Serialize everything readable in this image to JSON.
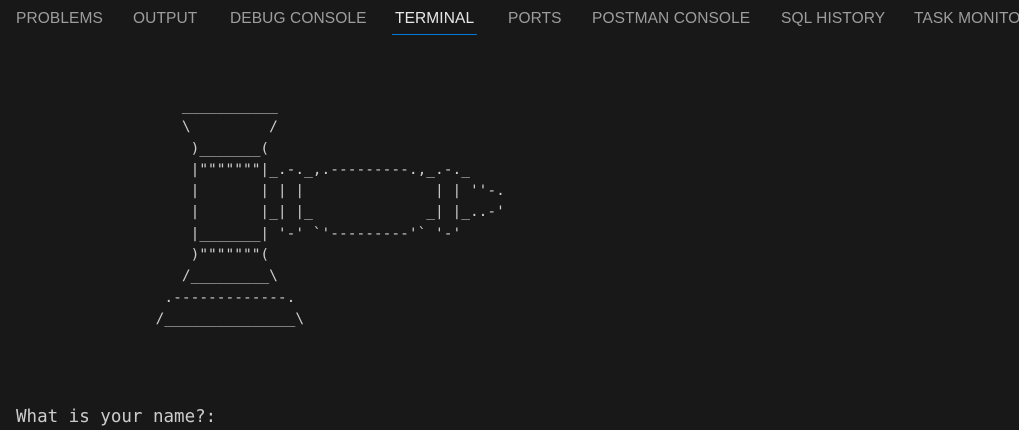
{
  "tabs": [
    {
      "label": "PROBLEMS",
      "active": false
    },
    {
      "label": "OUTPUT",
      "active": false
    },
    {
      "label": "DEBUG CONSOLE",
      "active": false
    },
    {
      "label": "TERMINAL",
      "active": true
    },
    {
      "label": "PORTS",
      "active": false
    },
    {
      "label": "POSTMAN CONSOLE",
      "active": false
    },
    {
      "label": "SQL HISTORY",
      "active": false
    },
    {
      "label": "TASK MONITO",
      "active": false
    }
  ],
  "terminal": {
    "ascii_art": "                   ___________\n                   \\         /\n                    )_______(\n                    |\"\"\"\"\"\"\"|_.-._,.---------.,_.-._\n                    |       | | |               | | ''-.\n                    |       |_| |_             _| |_..-'\n                    |_______| '-' `'---------'` '-'\n                    )\"\"\"\"\"\"\"(\n                   /_________\\\n                 .-------------.\n                /_______________\\",
    "prompt": "What is your name?:",
    "input_value": ""
  },
  "colors": {
    "background": "#181818",
    "tab_inactive": "#9d9d9d",
    "tab_active": "#e7e7e7",
    "active_underline": "#0078d4",
    "terminal_text": "#cccccc"
  }
}
